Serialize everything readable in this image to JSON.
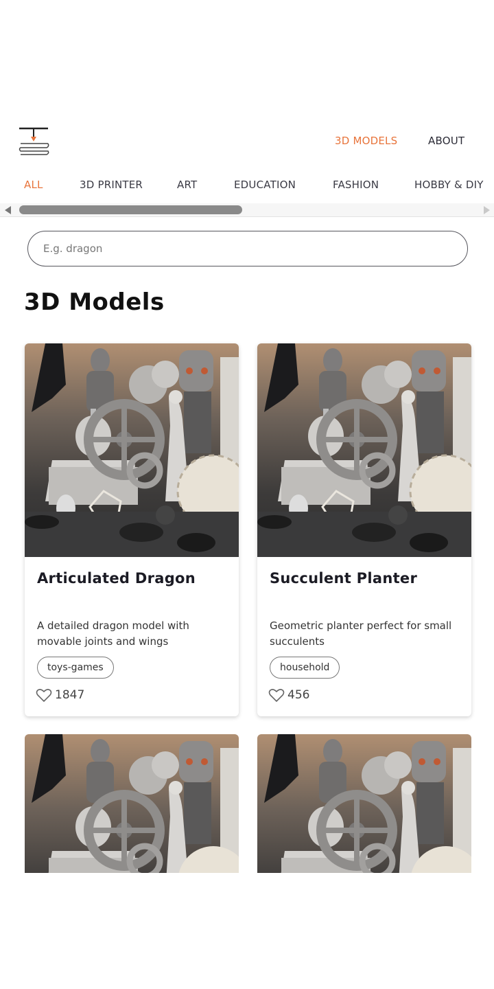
{
  "header": {
    "logo_icon": "3d-printer-nozzle-icon",
    "nav": [
      {
        "label": "3D MODELS",
        "active": true
      },
      {
        "label": "ABOUT",
        "active": false
      }
    ]
  },
  "categories": [
    {
      "label": "ALL",
      "active": true
    },
    {
      "label": "3D PRINTER",
      "active": false
    },
    {
      "label": "ART",
      "active": false
    },
    {
      "label": "EDUCATION",
      "active": false
    },
    {
      "label": "FASHION",
      "active": false
    },
    {
      "label": "HOBBY & DIY",
      "active": false
    }
  ],
  "search": {
    "placeholder": "E.g. dragon",
    "value": ""
  },
  "page_title": "3D Models",
  "models": [
    {
      "title": "Articulated Dragon",
      "description": "A detailed dragon model with movable joints and wings",
      "tag": "toys-games",
      "likes": "1847"
    },
    {
      "title": "Succulent Planter",
      "description": "Geometric planter perfect for small succulents",
      "tag": "household",
      "likes": "456"
    }
  ],
  "colors": {
    "accent": "#e8743b",
    "text": "#2b2b36"
  }
}
